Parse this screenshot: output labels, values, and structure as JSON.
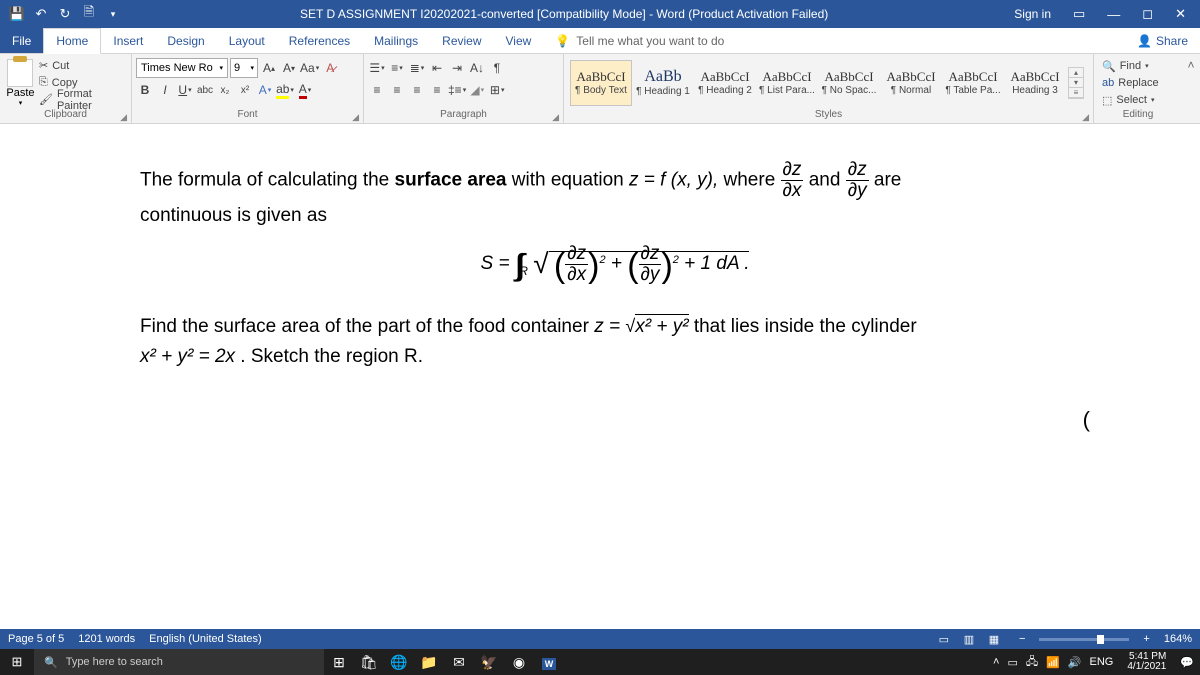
{
  "titlebar": {
    "title": "SET D ASSIGNMENT I20202021-converted [Compatibility Mode] - Word (Product Activation Failed)",
    "signin": "Sign in"
  },
  "tabs": {
    "file": "File",
    "home": "Home",
    "insert": "Insert",
    "design": "Design",
    "layout": "Layout",
    "references": "References",
    "mailings": "Mailings",
    "review": "Review",
    "view": "View",
    "tellme": "Tell me what you want to do",
    "share": "Share"
  },
  "clipboard": {
    "paste": "Paste",
    "cut": "Cut",
    "copy": "Copy",
    "painter": "Format Painter",
    "label": "Clipboard"
  },
  "font": {
    "name": "Times New Ro",
    "size": "9",
    "label": "Font"
  },
  "paragraph": {
    "label": "Paragraph"
  },
  "styles": {
    "label": "Styles",
    "items": [
      {
        "prev": "AaBbCcI",
        "name": "¶ Body Text"
      },
      {
        "prev": "AaBb",
        "name": "¶ Heading 1"
      },
      {
        "prev": "AaBbCcI",
        "name": "¶ Heading 2"
      },
      {
        "prev": "AaBbCcI",
        "name": "¶ List Para..."
      },
      {
        "prev": "AaBbCcI",
        "name": "¶ No Spac..."
      },
      {
        "prev": "AaBbCcI",
        "name": "¶ Normal"
      },
      {
        "prev": "AaBbCcI",
        "name": "¶ Table Pa..."
      },
      {
        "prev": "AaBbCcI",
        "name": "Heading 3"
      }
    ]
  },
  "editing": {
    "find": "Find",
    "replace": "Replace",
    "select": "Select",
    "label": "Editing"
  },
  "document": {
    "p1_a": "The formula of calculating the ",
    "p1_b": "surface area",
    "p1_c": " with equation ",
    "p1_eq": "z = f (x, y),",
    "p1_where": " where ",
    "p1_and": " and ",
    "p1_are": " are",
    "p2": "continuous is given as",
    "formula_tail": " + 1  dA .",
    "p3_a": "Find the surface area of the part of the food container ",
    "p3_eq1": "z = ",
    "p3_sqrt": "x² + y²",
    "p3_b": " that lies inside the cylinder",
    "p4_a": "x² + y² = 2x",
    "p4_b": " . Sketch the region R.",
    "p5": "("
  },
  "status": {
    "page": "Page 5 of 5",
    "words": "1201 words",
    "lang": "English (United States)",
    "zoom": "164%"
  },
  "taskbar": {
    "search": "Type here to search",
    "lang": "ENG",
    "time": "5:41 PM",
    "date": "4/1/2021"
  }
}
